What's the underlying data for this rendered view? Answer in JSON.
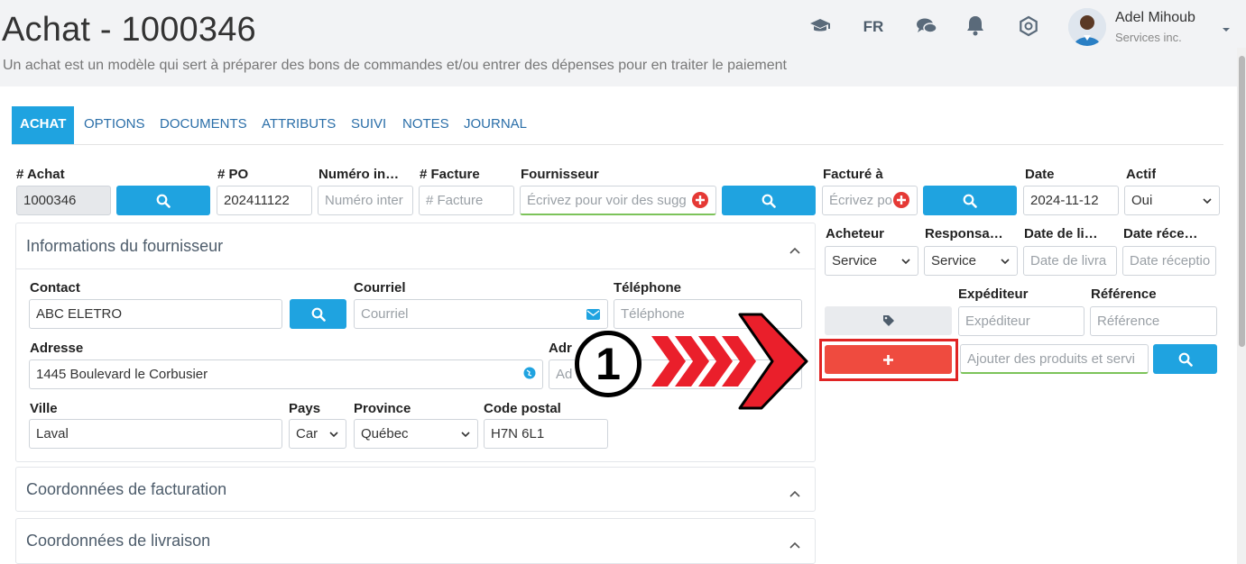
{
  "header": {
    "title": "Achat - 1000346",
    "subtitle": "Un achat est un modèle qui sert à préparer des bons de commandes et/ou entrer des dépenses pour en traiter le paiement",
    "language": "FR",
    "user_name": "Adel Mihoub",
    "user_company": "Services inc.",
    "icons": [
      "graduation-cap-icon",
      "chat-icon",
      "bell-icon",
      "settings-icon",
      "chevron-down-icon"
    ]
  },
  "tabs": [
    "ACHAT",
    "OPTIONS",
    "DOCUMENTS",
    "ATTRIBUTS",
    "SUIVI",
    "NOTES",
    "JOURNAL"
  ],
  "form": {
    "achat_label": "# Achat",
    "achat_value": "1000346",
    "po_label": "# PO",
    "po_value": "202411122",
    "numero_label": "Numéro in…",
    "numero_placeholder": "Numéro inter",
    "facture_label": "# Facture",
    "facture_placeholder": "# Facture",
    "fournisseur_label": "Fournisseur",
    "fournisseur_placeholder": "Écrivez pour voir des sugg",
    "facture_a_label": "Facturé à",
    "facture_a_placeholder": "Écrivez po",
    "date_label": "Date",
    "date_value": "2024-11-12",
    "actif_label": "Actif",
    "actif_value": "Oui",
    "acheteur_label": "Acheteur",
    "acheteur_value": "Service",
    "responsable_label": "Responsa…",
    "responsable_value": "Service",
    "date_livraison_label": "Date de li…",
    "date_livraison_placeholder": "Date de livra",
    "date_reception_label": "Date réce…",
    "date_reception_placeholder": "Date réceptio",
    "expediteur_label": "Expéditeur",
    "expediteur_placeholder": "Expéditeur",
    "reference_label": "Référence",
    "reference_placeholder": "Référence",
    "produits_placeholder": "Ajouter des produits et servi"
  },
  "supplier_panel": {
    "title": "Informations du fournisseur",
    "contact_label": "Contact",
    "contact_value": "ABC ELETRO",
    "courriel_label": "Courriel",
    "courriel_placeholder": "Courriel",
    "telephone_label": "Téléphone",
    "telephone_placeholder": "Téléphone",
    "adresse_label": "Adresse",
    "adresse_value": "1445 Boulevard le Corbusier",
    "adresse2_label": "Adr",
    "adresse2_placeholder": "Ad",
    "ville_label": "Ville",
    "ville_value": "Laval",
    "pays_label": "Pays",
    "pays_value": "Car",
    "province_label": "Province",
    "province_value": "Québec",
    "code_postal_label": "Code postal",
    "code_postal_value": "H7N 6L1"
  },
  "panels": {
    "facturation_title": "Coordonnées de facturation",
    "livraison_title": "Coordonnées de livraison"
  },
  "annotation": {
    "step_number": "1"
  },
  "colors": {
    "primary": "#1fa3e0",
    "danger": "#ef4b3f",
    "highlight": "#e02424",
    "success": "#7cc35a"
  }
}
